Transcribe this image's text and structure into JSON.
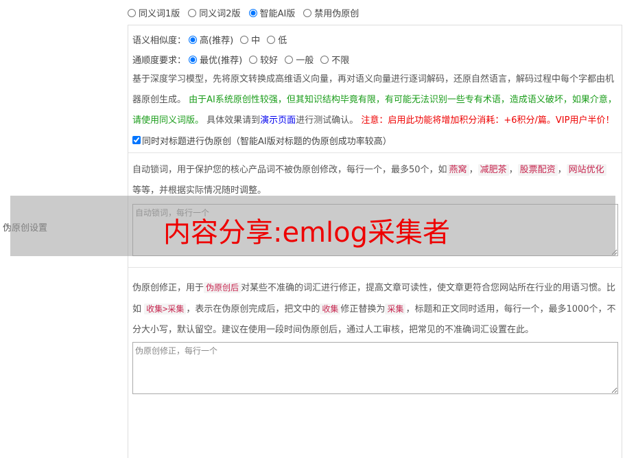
{
  "mode_options": [
    {
      "label": "同义词1版",
      "checked": false
    },
    {
      "label": "同义词2版",
      "checked": false
    },
    {
      "label": "智能AI版",
      "checked": true
    },
    {
      "label": "禁用伪原创",
      "checked": false
    }
  ],
  "row_label": "伪原创设置",
  "similarity": {
    "label": "语义相似度：",
    "options": [
      {
        "label": "高(推荐)",
        "checked": true
      },
      {
        "label": "中",
        "checked": false
      },
      {
        "label": "低",
        "checked": false
      }
    ]
  },
  "fluency": {
    "label": "通顺度要求：",
    "options": [
      {
        "label": "最优(推荐)",
        "checked": true
      },
      {
        "label": "较好",
        "checked": false
      },
      {
        "label": "一般",
        "checked": false
      },
      {
        "label": "不限",
        "checked": false
      }
    ]
  },
  "ai_desc": {
    "part1": "基于深度学习模型，先将原文转换成高维语义向量，再对语义向量进行逐词解码，还原自然语言，解码过程中每个字都由机器原创生成。",
    "green": "由于AI系统原创性较强，但其知识结构毕竟有限，有可能无法识别一些专有术语，造成语义破坏，如果介意，请使用同义词版。",
    "part2": "具体效果请到",
    "link": "演示页面",
    "part3": "进行测试确认。",
    "red": "注意：启用此功能将增加积分消耗：+6积分/篇。VIP用户半价！"
  },
  "title_checkbox": {
    "label": "同时对标题进行伪原创（智能AI版对标题的伪原创成功率较高）",
    "checked": true
  },
  "lock_words": {
    "desc_a": "自动锁词，用于保护您的核心产品词不被伪原创修改，每行一个，最多50个，如",
    "examples": [
      "燕窝",
      "减肥茶",
      "股票配资",
      "网站优化"
    ],
    "desc_b": "等等，并根据实际情况随时调整。",
    "placeholder": "自动锁词，每行一个"
  },
  "correction": {
    "p1": "伪原创修正，用于",
    "t1": "伪原创后",
    "p2": "对某些不准确的词汇进行修正，提高文章可读性，使文章更符合您网站所在行业的用语习惯。比如",
    "t2": "收集>采集",
    "p3": "，表示在伪原创完成后，把文中的",
    "t3": "收集",
    "p4": "修正替换为",
    "t4": "采集",
    "p5": "，标题和正文同时适用，每行一个，最多1000个，不分大小写，默认留空。建议在使用一段时间伪原创后，通过人工审核，把常见的不准确词汇设置在此。",
    "placeholder": "伪原创修正，每行一个"
  },
  "watermark": "内容分享:emlog采集者"
}
